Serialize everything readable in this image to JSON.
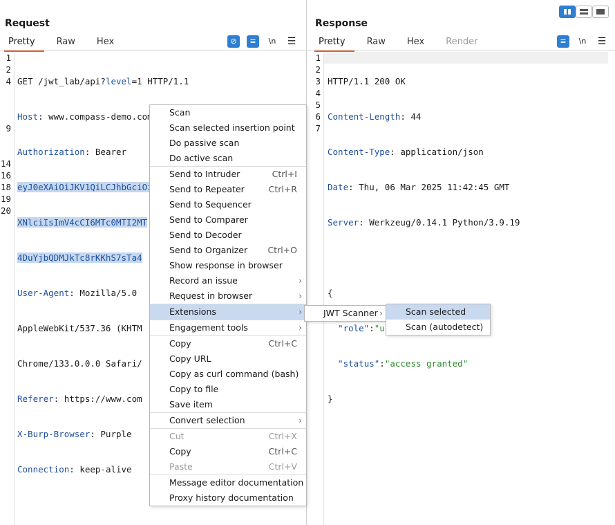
{
  "view_toggle_icons": [
    "split-columns-icon",
    "split-rows-icon",
    "single-pane-icon"
  ],
  "request": {
    "title": "Request",
    "tabs": [
      "Pretty",
      "Raw",
      "Hex"
    ],
    "active_tab": "Pretty",
    "toolbar": {
      "newline_label": "\\n"
    },
    "line_numbers": [
      "1",
      "2",
      "4",
      "",
      "",
      "9",
      "",
      "",
      "14",
      "16",
      "18",
      "19",
      "20"
    ],
    "lines": [
      {
        "key": "GET /jwt_lab/api?",
        "k2": "level",
        "v": "=1 HTTP/1.1"
      },
      {
        "key": "Host",
        "v": ": www.compass-demo.com"
      },
      {
        "key": "Authorization",
        "v": ": Bearer"
      },
      {
        "sel": "eyJ0eXAiOiJKV1QiLCJhbGciOiJIUzI1NiJ9.eyJyb2xlIjoid"
      },
      {
        "sel": "XNlciIsImV4cCI6MTc0MTI2MT"
      },
      {
        "sel": "4DuYjbQDMJkTc8rKKhS7sTa4"
      },
      {
        "key": "User-Agent",
        "v": ": Mozilla/5.0"
      },
      {
        "v": "AppleWebKit/537.36 (KHTM"
      },
      {
        "v": "Chrome/133.0.0.0 Safari/"
      },
      {
        "key": "Referer",
        "v": ": https://www.com"
      },
      {
        "key": "X-Burp-Browser",
        "v": ": Purple"
      },
      {
        "key": "Connection",
        "v": ": keep-alive"
      }
    ]
  },
  "response": {
    "title": "Response",
    "tabs": [
      "Pretty",
      "Raw",
      "Hex",
      "Render"
    ],
    "active_tab": "Pretty",
    "toolbar": {
      "newline_label": "\\n"
    },
    "line_numbers": [
      "1",
      "2",
      "3",
      "4",
      "5",
      "6",
      "7"
    ],
    "status_line": "HTTP/1.1 200 OK",
    "headers": [
      {
        "key": "Content-Length",
        "v": ": 44"
      },
      {
        "key": "Content-Type",
        "v": ": application/json"
      },
      {
        "key": "Date",
        "v": ": Thu, 06 Mar 2025 11:42:45 GMT"
      },
      {
        "key": "Server",
        "v": ": Werkzeug/0.14.1 Python/3.9.19"
      }
    ],
    "body": {
      "open": "{",
      "role_key": "\"role\"",
      "role_val": "\"user\"",
      "status_key": "\"status\"",
      "status_val": "\"access granted\"",
      "close": "}"
    }
  },
  "context_menu": {
    "items": [
      {
        "label": "Scan"
      },
      {
        "label": "Scan selected insertion point"
      },
      {
        "label": "Do passive scan"
      },
      {
        "label": "Do active scan"
      },
      {
        "sep": true
      },
      {
        "label": "Send to Intruder",
        "shortcut": "Ctrl+I"
      },
      {
        "label": "Send to Repeater",
        "shortcut": "Ctrl+R"
      },
      {
        "label": "Send to Sequencer"
      },
      {
        "label": "Send to Comparer"
      },
      {
        "label": "Send to Decoder"
      },
      {
        "label": "Send to Organizer",
        "shortcut": "Ctrl+O"
      },
      {
        "label": "Show response in browser"
      },
      {
        "label": "Record an issue",
        "submenu": true
      },
      {
        "label": "Request in browser",
        "submenu": true
      },
      {
        "sep": true
      },
      {
        "label": "Extensions",
        "submenu": true,
        "highlight": true
      },
      {
        "sep": true
      },
      {
        "label": "Engagement tools",
        "submenu": true
      },
      {
        "sep": true
      },
      {
        "label": "Copy",
        "shortcut": "Ctrl+C"
      },
      {
        "label": "Copy URL"
      },
      {
        "label": "Copy as curl command (bash)"
      },
      {
        "label": "Copy to file"
      },
      {
        "label": "Save item"
      },
      {
        "sep": true
      },
      {
        "label": "Convert selection",
        "submenu": true
      },
      {
        "sep": true
      },
      {
        "label": "Cut",
        "shortcut": "Ctrl+X",
        "disabled": true
      },
      {
        "label": "Copy",
        "shortcut": "Ctrl+C"
      },
      {
        "label": "Paste",
        "shortcut": "Ctrl+V",
        "disabled": true
      },
      {
        "sep": true
      },
      {
        "label": "Message editor documentation"
      },
      {
        "label": "Proxy history documentation"
      }
    ]
  },
  "extensions_submenu": {
    "item": "JWT Scanner"
  },
  "jwt_submenu": {
    "items": [
      "Scan selected",
      "Scan (autodetect)"
    ]
  }
}
